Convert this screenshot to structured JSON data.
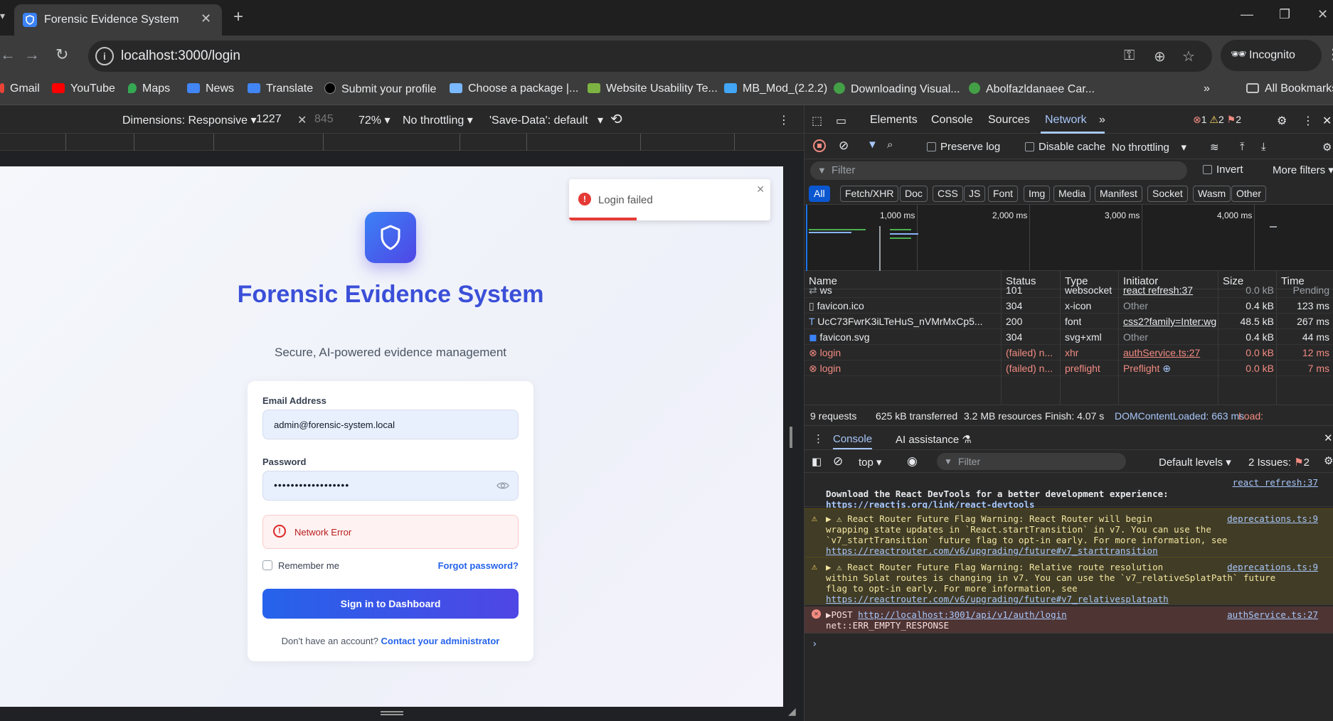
{
  "browser": {
    "tab_title": "Forensic Evidence System",
    "url": "localhost:3000/login",
    "incognito_label": "Incognito",
    "bookmarks": [
      {
        "label": "Gmail",
        "color": "#ea4335"
      },
      {
        "label": "YouTube",
        "color": "#ff0000"
      },
      {
        "label": "Maps",
        "color": "#34a853"
      },
      {
        "label": "News",
        "color": "#4285f4"
      },
      {
        "label": "Translate",
        "color": "#4285f4"
      },
      {
        "label": "Submit your profile",
        "color": "#111111"
      },
      {
        "label": "Choose a package |...",
        "color": "#7ab8ff"
      },
      {
        "label": "Website Usability Te...",
        "color": "#7cb342"
      },
      {
        "label": "MB_Mod_(2.2.2)",
        "color": "#42a5f5"
      },
      {
        "label": "Downloading Visual...",
        "color": "#43a047"
      },
      {
        "label": "Abolfazldanaee Car...",
        "color": "#43a047"
      }
    ],
    "all_bookmarks": "All Bookmarks"
  },
  "device_toolbar": {
    "dimensions": "Dimensions: Responsive",
    "width": "1227",
    "height": "845",
    "zoom": "72%",
    "throttling": "No throttling",
    "save_data": "'Save-Data': default"
  },
  "app": {
    "title": "Forensic Evidence System",
    "subtitle": "Secure, AI-powered evidence management",
    "email_label": "Email Address",
    "email_value": "admin@forensic-system.local",
    "password_label": "Password",
    "password_value": "••••••••••••••••••",
    "error_text": "Network Error",
    "remember_label": "Remember me",
    "forgot_label": "Forgot password?",
    "signin_label": "Sign in to Dashboard",
    "footer_text": "Don't have an account?",
    "footer_link": "Contact your administrator",
    "toast_text": "Login failed"
  },
  "devtools": {
    "tabs": [
      "Elements",
      "Console",
      "Sources",
      "Network"
    ],
    "badges": {
      "errors": "1",
      "warnings": "2",
      "issues": "2"
    },
    "netbar": {
      "preserve_log": "Preserve log",
      "disable_cache": "Disable cache",
      "throttling": "No throttling"
    },
    "filter_placeholder": "Filter",
    "invert": "Invert",
    "more_filters": "More filters",
    "chips": [
      "All",
      "Fetch/XHR",
      "Doc",
      "CSS",
      "JS",
      "Font",
      "Img",
      "Media",
      "Manifest",
      "Socket",
      "Wasm",
      "Other"
    ],
    "timeline_labels": [
      "1,000 ms",
      "2,000 ms",
      "3,000 ms",
      "4,000 ms"
    ],
    "columns": [
      "Name",
      "Status",
      "Type",
      "Initiator",
      "Size",
      "Time"
    ],
    "rows": [
      {
        "name": "ws",
        "status": "101",
        "type": "websocket",
        "initiator": "react refresh:37",
        "size": "0.0 kB",
        "time": "Pending",
        "failed": false
      },
      {
        "name": "favicon.ico",
        "status": "304",
        "type": "x-icon",
        "initiator": "Other",
        "size": "0.4 kB",
        "time": "123 ms",
        "failed": false
      },
      {
        "name": "UcC73FwrK3iLTeHuS_nVMrMxCp5...",
        "status": "200",
        "type": "font",
        "initiator": "css2?family=Inter:wg",
        "size": "48.5 kB",
        "time": "267 ms",
        "failed": false
      },
      {
        "name": "favicon.svg",
        "status": "304",
        "type": "svg+xml",
        "initiator": "Other",
        "size": "0.4 kB",
        "time": "44 ms",
        "failed": false
      },
      {
        "name": "login",
        "status": "(failed) n...",
        "type": "xhr",
        "initiator": "authService.ts:27",
        "size": "0.0 kB",
        "time": "12 ms",
        "failed": true
      },
      {
        "name": "login",
        "status": "(failed) n...",
        "type": "preflight",
        "initiator": "Preflight",
        "size": "0.0 kB",
        "time": "7 ms",
        "failed": true
      }
    ],
    "summary": {
      "requests": "9 requests",
      "transferred": "625 kB transferred",
      "resources": "3.2 MB resources",
      "finish": "Finish: 4.07 s",
      "domcontent": "DOMContentLoaded: 663 ms",
      "load": "Load:"
    },
    "drawer_tabs": [
      "Console",
      "AI assistance"
    ],
    "console_toolbar": {
      "context": "top",
      "filter": "Filter",
      "levels": "Default levels",
      "issues": "2 Issues:",
      "issues_count": "2"
    },
    "console": {
      "m1_src": "react refresh:37",
      "m1_line1": "Download the React DevTools for a better development experience:",
      "m1_link": "https://reactjs.org/link/react-devtools",
      "m2_src": "deprecations.ts:9",
      "m2_line1": "▶ ⚠ React Router Future Flag Warning: React Router will begin",
      "m2_line2": "wrapping state updates in `React.startTransition` in v7. You can use the",
      "m2_line3": "`v7_startTransition` future flag to opt-in early. For more information, see",
      "m2_link": "https://reactrouter.com/v6/upgrading/future#v7_starttransition",
      "m3_src": "deprecations.ts:9",
      "m3_line1": "▶ ⚠ React Router Future Flag Warning: Relative route resolution",
      "m3_line2": "within Splat routes is changing in v7. You can use the `v7_relativeSplatPath` future",
      "m3_line3": "flag to opt-in early. For more information, see",
      "m3_link": "https://reactrouter.com/v6/upgrading/future#v7_relativesplatpath",
      "m4_src": "authService.ts:27",
      "m4_prefix": "▶POST ",
      "m4_link": "http://localhost:3001/api/v1/auth/login",
      "m4_line2": "net::ERR_EMPTY_RESPONSE"
    }
  }
}
